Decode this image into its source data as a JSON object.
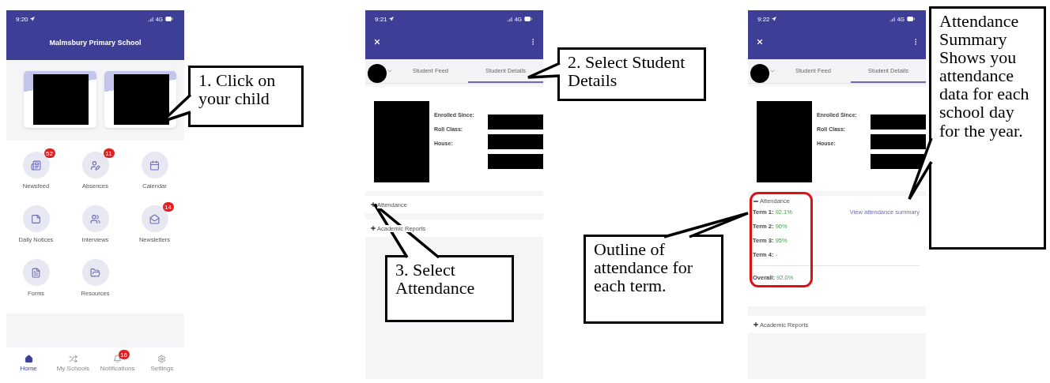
{
  "phones": [
    {
      "kind": "home",
      "time": "9:20",
      "network": "4G",
      "title": "Malmsbury Primary School",
      "tiles": [
        {
          "label": "Newsfeed",
          "badge": "52"
        },
        {
          "label": "Absences",
          "badge": "11"
        },
        {
          "label": "Calendar"
        },
        {
          "label": "Daily Notices"
        },
        {
          "label": "Interviews"
        },
        {
          "label": "Newsletters",
          "badge": "14"
        },
        {
          "label": "Forms"
        },
        {
          "label": "Resources"
        }
      ],
      "nav": [
        {
          "label": "Home",
          "selected": true
        },
        {
          "label": "My Schools",
          "selected": false
        },
        {
          "label": "Notifications",
          "selected": false,
          "badge": "16"
        },
        {
          "label": "Settings",
          "selected": false
        }
      ]
    },
    {
      "kind": "details",
      "time": "9:21",
      "network": "4G",
      "tabs": [
        {
          "label": "Student Feed",
          "selected": false
        },
        {
          "label": "Student Details",
          "selected": true
        }
      ],
      "fields": [
        "Enrolled Since:",
        "Roll Class:",
        "House:"
      ],
      "sections": [
        {
          "label": "Attendance",
          "expanded": false
        },
        {
          "label": "Academic Reports",
          "expanded": false
        }
      ]
    },
    {
      "kind": "details",
      "time": "9:22",
      "network": "4G",
      "tabs": [
        {
          "label": "Student Feed",
          "selected": false
        },
        {
          "label": "Student Details",
          "selected": true
        }
      ],
      "fields": [
        "Enrolled Since:",
        "Roll Class:",
        "House:"
      ],
      "sections": [
        {
          "label": "Attendance",
          "expanded": true,
          "terms": [
            {
              "label": "Term 1:",
              "value": "92.1%"
            },
            {
              "label": "Term 2:",
              "value": "90%"
            },
            {
              "label": "Term 3:",
              "value": "95%"
            },
            {
              "label": "Term 4:",
              "value": "-"
            }
          ],
          "link": "View attendance summary",
          "overall": {
            "label": "Overall:",
            "value": "92.0%"
          }
        },
        {
          "label": "Academic Reports",
          "expanded": false
        }
      ]
    }
  ],
  "callouts": [
    {
      "text": "1. Click on your child"
    },
    {
      "text": "2. Select Student Details"
    },
    {
      "text": "3. Select Attendance"
    },
    {
      "text": "Outline of attendance for each term."
    },
    {
      "text": "Attendance Summary Shows you attendance data for each school day for the year."
    }
  ]
}
